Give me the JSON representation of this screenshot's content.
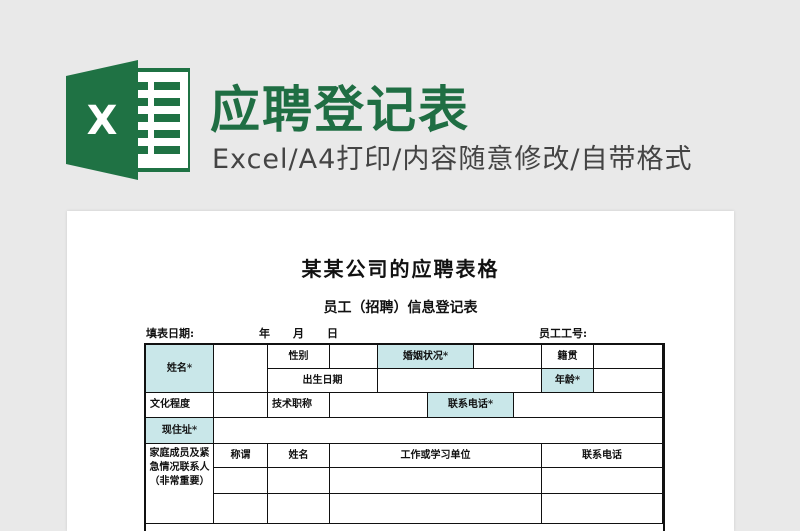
{
  "header": {
    "title": "应聘登记表",
    "subtitle": "Excel/A4打印/内容随意修改/自带格式"
  },
  "logo": {
    "icon": "excel-icon",
    "letter": "X",
    "color": "#1f7244"
  },
  "document": {
    "title": "某某公司的应聘表格",
    "subtitle": "员工（招聘）信息登记表",
    "fill_date_label": "填表日期:",
    "year": "年",
    "month": "月",
    "day": "日",
    "employee_no_label": "员工工号:"
  },
  "form": {
    "name": "姓名*",
    "gender": "性别",
    "marital": "婚姻状况*",
    "origin": "籍贯",
    "birth": "出生日期",
    "age": "年龄*",
    "education": "文化程度",
    "title": "技术职称",
    "phone": "联系电话*",
    "address": "现住址*",
    "family": "家庭成员及紧急情况联系人（非常重要）",
    "relation": "称谓",
    "member_name": "姓名",
    "work_unit": "工作或学习单位",
    "member_phone": "联系电话"
  },
  "colors": {
    "accent": "#1f6e43",
    "highlight": "#c9e7e9"
  }
}
